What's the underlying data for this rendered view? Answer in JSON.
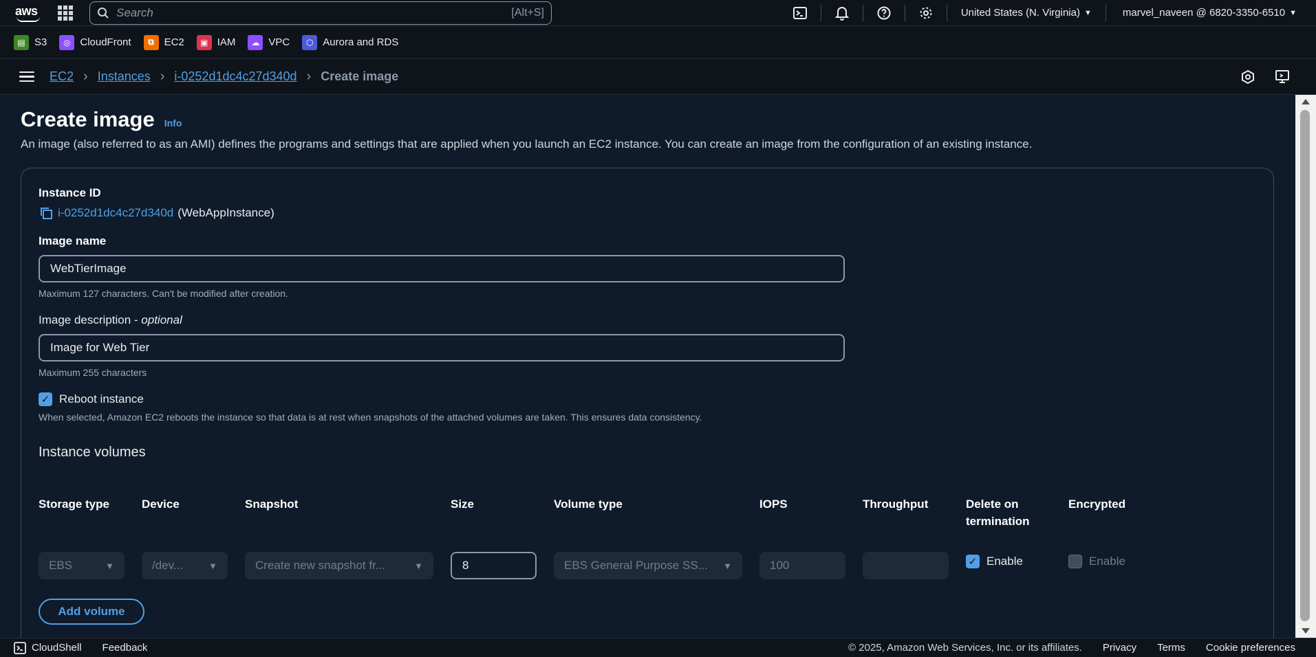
{
  "topnav": {
    "logo_text": "aws",
    "search_placeholder": "Search",
    "search_shortcut": "[Alt+S]",
    "icons": [
      "cloudshell-icon",
      "bell-icon",
      "help-icon",
      "gear-icon"
    ],
    "region": "United States (N. Virginia)",
    "account": "marvel_naveen @ 6820-3350-6510"
  },
  "favorites": [
    {
      "label": "S3",
      "icon": "s3-icon",
      "color": "#3f8624"
    },
    {
      "label": "CloudFront",
      "icon": "cloudfront-icon",
      "color": "#8c4fff"
    },
    {
      "label": "EC2",
      "icon": "ec2-icon",
      "color": "#ed7100"
    },
    {
      "label": "IAM",
      "icon": "iam-icon",
      "color": "#dd344c"
    },
    {
      "label": "VPC",
      "icon": "vpc-icon",
      "color": "#8c4fff"
    },
    {
      "label": "Aurora and RDS",
      "icon": "rds-icon",
      "color": "#4d5bd9"
    }
  ],
  "breadcrumb": {
    "items": [
      "EC2",
      "Instances",
      "i-0252d1dc4c27d340d"
    ],
    "current": "Create image"
  },
  "page": {
    "title": "Create image",
    "info": "Info",
    "description": "An image (also referred to as an AMI) defines the programs and settings that are applied when you launch an EC2 instance. You can create an image from the configuration of an existing instance."
  },
  "form": {
    "instance_id_label": "Instance ID",
    "instance_id": "i-0252d1dc4c27d340d",
    "instance_name": "(WebAppInstance)",
    "image_name_label": "Image name",
    "image_name_value": "WebTierImage",
    "image_name_hint": "Maximum 127 characters. Can't be modified after creation.",
    "image_desc_label": "Image description",
    "image_desc_optional": "optional",
    "image_desc_value": "Image for Web Tier",
    "image_desc_hint": "Maximum 255 characters",
    "reboot_label": "Reboot instance",
    "reboot_checked": true,
    "reboot_hint": "When selected, Amazon EC2 reboots the instance so that data is at rest when snapshots of the attached volumes are taken. This ensures data consistency."
  },
  "volumes": {
    "title": "Instance volumes",
    "headers": {
      "storage_type": "Storage type",
      "device": "Device",
      "snapshot": "Snapshot",
      "size": "Size",
      "volume_type": "Volume type",
      "iops": "IOPS",
      "throughput": "Throughput",
      "delete_on_termination_1": "Delete on",
      "delete_on_termination_2": "termination",
      "encrypted": "Encrypted"
    },
    "row": {
      "storage_type": "EBS",
      "device": "/dev...",
      "snapshot": "Create new snapshot fr...",
      "size": "8",
      "volume_type": "EBS General Purpose SS...",
      "iops": "100",
      "throughput": "",
      "delete_on_termination": "Enable",
      "delete_on_termination_checked": true,
      "encrypted": "Enable",
      "encrypted_checked": false
    },
    "add_button": "Add volume"
  },
  "footer": {
    "cloudshell": "CloudShell",
    "feedback": "Feedback",
    "copyright": "© 2025, Amazon Web Services, Inc. or its affiliates.",
    "privacy": "Privacy",
    "terms": "Terms",
    "cookies": "Cookie preferences"
  }
}
